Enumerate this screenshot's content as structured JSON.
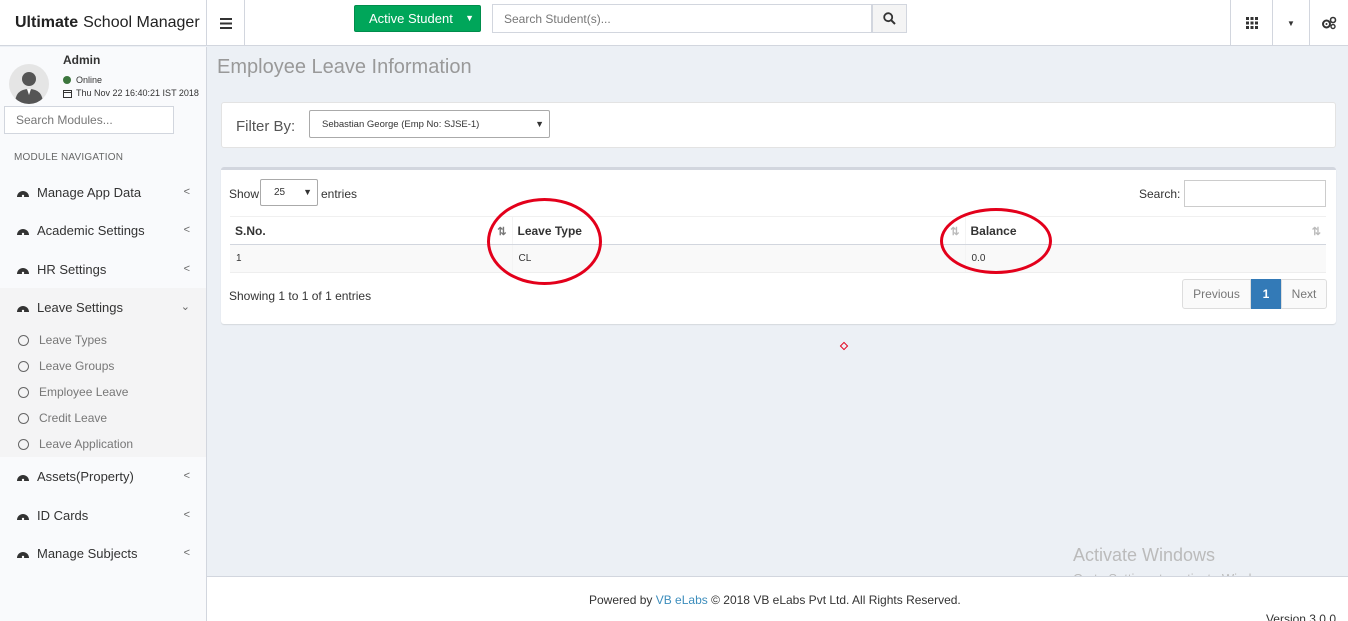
{
  "header": {
    "brand_bold": "Ultimate",
    "brand_rest": "School Manager",
    "active_student_label": "Active Student",
    "search_placeholder": "Search Student(s)..."
  },
  "user": {
    "name": "Admin",
    "status": "Online",
    "datetime": "Thu Nov 22 16:40:21 IST 2018"
  },
  "sidebar": {
    "search_placeholder": "Search Modules...",
    "header": "MODULE NAVIGATION",
    "items": [
      {
        "label": "Manage App Data"
      },
      {
        "label": "Academic Settings"
      },
      {
        "label": "HR Settings"
      },
      {
        "label": "Leave Settings"
      },
      {
        "label": "Assets(Property)"
      },
      {
        "label": "ID Cards"
      },
      {
        "label": "Manage Subjects"
      }
    ],
    "sub_items": [
      {
        "label": "Leave Types"
      },
      {
        "label": "Leave Groups"
      },
      {
        "label": "Employee Leave"
      },
      {
        "label": "Credit Leave"
      },
      {
        "label": "Leave Application"
      }
    ]
  },
  "page": {
    "title": "Employee Leave Information",
    "filter_label": "Filter By:",
    "filter_value": "Sebastian George (Emp No: SJSE-1)"
  },
  "table": {
    "show_label": "Show",
    "entries_value": "25",
    "entries_label": "entries",
    "search_label": "Search:",
    "columns": [
      "S.No.",
      "Leave Type",
      "Balance"
    ],
    "rows": [
      [
        "1",
        "CL",
        "0.0"
      ]
    ],
    "showing": "Showing 1 to 1 of 1 entries",
    "prev_label": "Previous",
    "current_page": "1",
    "next_label": "Next"
  },
  "footer": {
    "powered_by": "Powered by",
    "company_link": "VB eLabs",
    "copyright": "© 2018 VB eLabs Pvt Ltd. All Rights Reserved.",
    "version": "Version 3.0.0"
  },
  "watermark": {
    "line1": "Activate Windows",
    "line2": "Go to Settings to activate Windows."
  },
  "colors": {
    "accent_green": "#00a65a",
    "pager_blue": "#337ab7",
    "annotation_red": "#e3001b"
  }
}
